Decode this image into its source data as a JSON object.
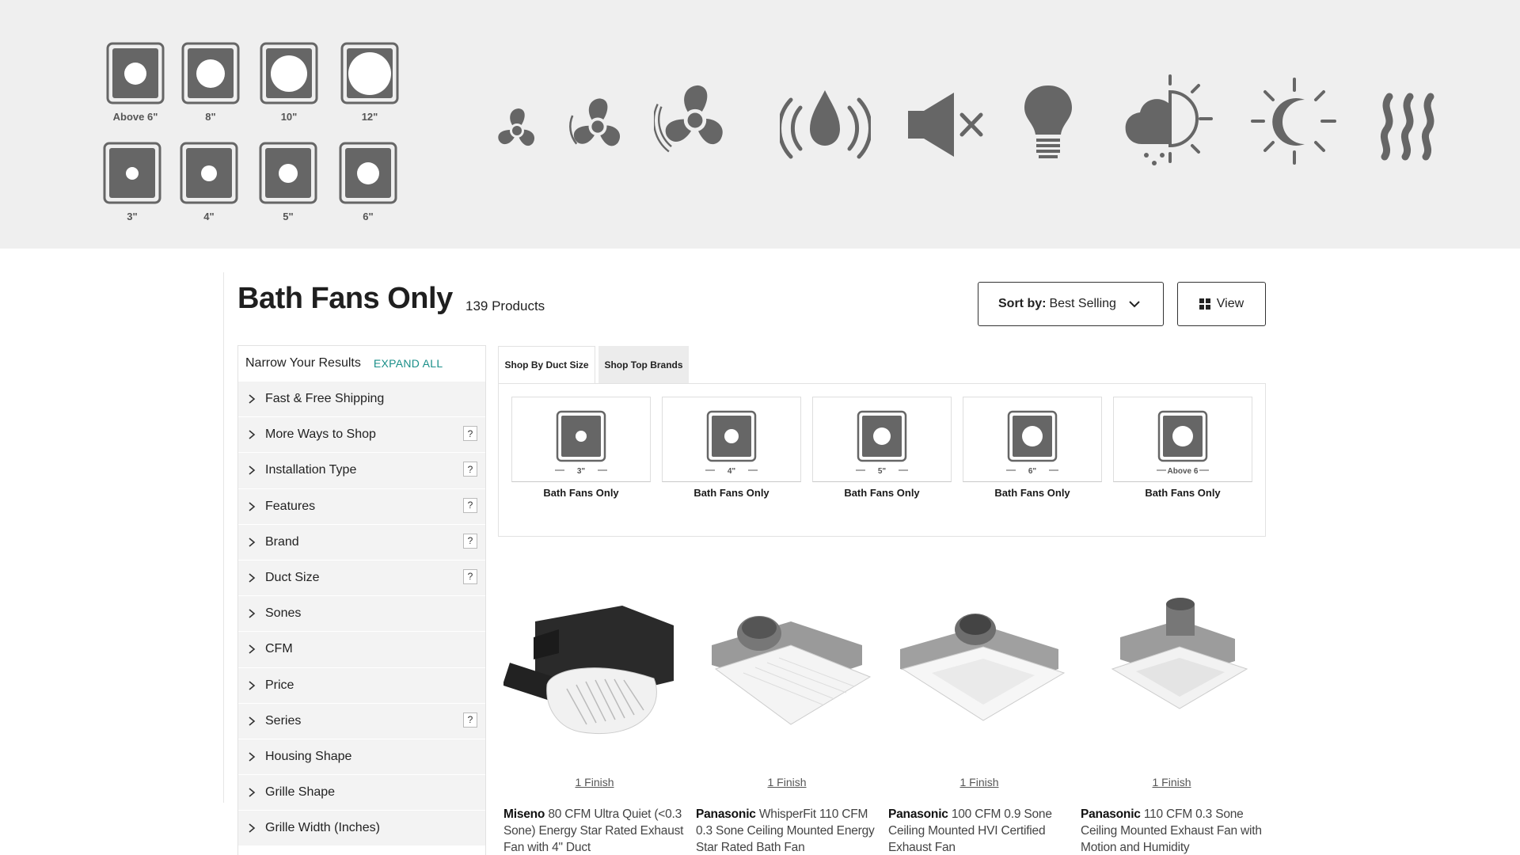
{
  "banner": {
    "duct_sizes_large": [
      "Above 6\"",
      "8\"",
      "10\"",
      "12\""
    ],
    "duct_sizes_small": [
      "3\"",
      "4\"",
      "5\"",
      "6\""
    ],
    "feature_icons": [
      "fan-small-icon",
      "fan-medium-icon",
      "fan-large-icon",
      "humidity-sensor-icon",
      "quiet-mute-icon",
      "light-bulb-icon",
      "weather-icon",
      "day-night-icon",
      "heater-icon"
    ],
    "icon_color": "#666666",
    "background_color": "#efefef"
  },
  "header": {
    "title": "Bath Fans Only",
    "product_count": "139 Products",
    "sort_prefix": "Sort by:",
    "sort_value": "Best Selling",
    "view_label": "View"
  },
  "filters": {
    "heading": "Narrow Your Results",
    "expand_all": "EXPAND ALL",
    "accent_color": "#1a8f89",
    "items": [
      {
        "label": "Fast & Free Shipping",
        "help": ""
      },
      {
        "label": "More Ways to Shop",
        "help": "?"
      },
      {
        "label": "Installation Type",
        "help": "?"
      },
      {
        "label": "Features",
        "help": "?"
      },
      {
        "label": "Brand",
        "help": "?"
      },
      {
        "label": "Duct Size",
        "help": "?"
      },
      {
        "label": "Sones",
        "help": ""
      },
      {
        "label": "CFM",
        "help": ""
      },
      {
        "label": "Price",
        "help": ""
      },
      {
        "label": "Series",
        "help": "?"
      },
      {
        "label": "Housing Shape",
        "help": ""
      },
      {
        "label": "Grille Shape",
        "help": ""
      },
      {
        "label": "Grille Width (Inches)",
        "help": ""
      }
    ]
  },
  "tabs": [
    {
      "label": "Shop By Duct Size",
      "active": true
    },
    {
      "label": "Shop Top Brands",
      "active": false
    }
  ],
  "duct_tiles": [
    {
      "size": "3\"",
      "caption": "Bath Fans Only"
    },
    {
      "size": "4\"",
      "caption": "Bath Fans Only"
    },
    {
      "size": "5\"",
      "caption": "Bath Fans Only"
    },
    {
      "size": "6\"",
      "caption": "Bath Fans Only"
    },
    {
      "size": "Above 6",
      "caption": "Bath Fans Only"
    }
  ],
  "products": [
    {
      "brand": "Miseno",
      "title": "80 CFM Ultra Quiet (<0.3 Sone) Energy Star Rated Exhaust Fan with 4\" Duct",
      "finish": "1 Finish"
    },
    {
      "brand": "Panasonic",
      "title": "WhisperFit 110 CFM 0.3 Sone Ceiling Mounted Energy Star Rated Bath Fan",
      "finish": "1 Finish"
    },
    {
      "brand": "Panasonic",
      "title": "100 CFM 0.9 Sone Ceiling Mounted HVI Certified Exhaust Fan",
      "finish": "1 Finish"
    },
    {
      "brand": "Panasonic",
      "title": "110 CFM 0.3 Sone Ceiling Mounted Exhaust Fan with Motion and Humidity",
      "finish": "1 Finish"
    }
  ]
}
